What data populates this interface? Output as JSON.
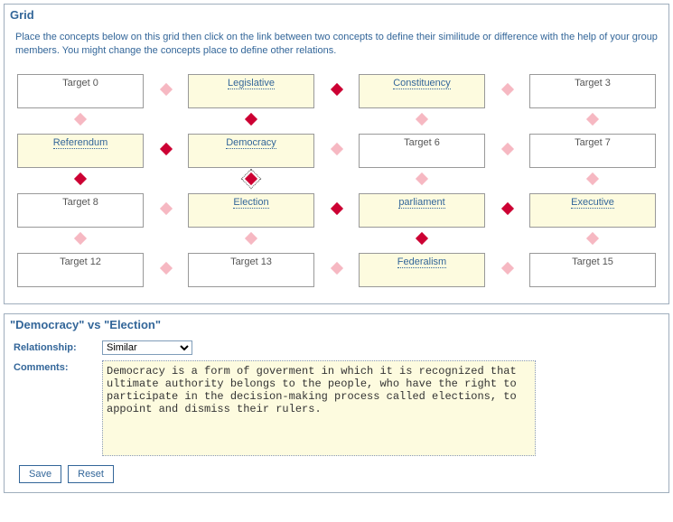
{
  "grid_panel": {
    "title": "Grid",
    "instructions": "Place the concepts below on this grid then click on the link between two concepts to define their similitude or difference with the help of your group members. You might change the concepts place to define other relations."
  },
  "cells": [
    [
      {
        "label": "Target 0",
        "filled": false
      },
      {
        "label": "Legislative",
        "filled": true
      },
      {
        "label": "Constituency",
        "filled": true
      },
      {
        "label": "Target 3",
        "filled": false
      }
    ],
    [
      {
        "label": "Referendum",
        "filled": true
      },
      {
        "label": "Democracy",
        "filled": true
      },
      {
        "label": "Target 6",
        "filled": false
      },
      {
        "label": "Target 7",
        "filled": false
      }
    ],
    [
      {
        "label": "Target 8",
        "filled": false
      },
      {
        "label": "Election",
        "filled": true
      },
      {
        "label": "parliament",
        "filled": true
      },
      {
        "label": "Executive",
        "filled": true
      }
    ],
    [
      {
        "label": "Target 12",
        "filled": false
      },
      {
        "label": "Target 13",
        "filled": false
      },
      {
        "label": "Federalism",
        "filled": true
      },
      {
        "label": "Target 15",
        "filled": false
      }
    ]
  ],
  "hlinks": [
    [
      "light",
      "dark",
      "light"
    ],
    [
      "dark",
      "light",
      "light"
    ],
    [
      "light",
      "dark",
      "dark"
    ],
    [
      "light",
      "light",
      "light"
    ]
  ],
  "vlinks": [
    [
      "light",
      "dark",
      "light",
      "light"
    ],
    [
      "dark",
      "sel",
      "light",
      "light"
    ],
    [
      "light",
      "light",
      "dark",
      "light"
    ]
  ],
  "compare": {
    "title": "\"Democracy\" vs \"Election\"",
    "relationship_label": "Relationship:",
    "relationship_value": "Similar",
    "comments_label": "Comments:",
    "comments_value": "Democracy is a form of goverment in which it is recognized that ultimate authority belongs to the people, who have the right to participate in the decision-making process called elections, to appoint and dismiss their rulers.",
    "save": "Save",
    "reset": "Reset"
  }
}
